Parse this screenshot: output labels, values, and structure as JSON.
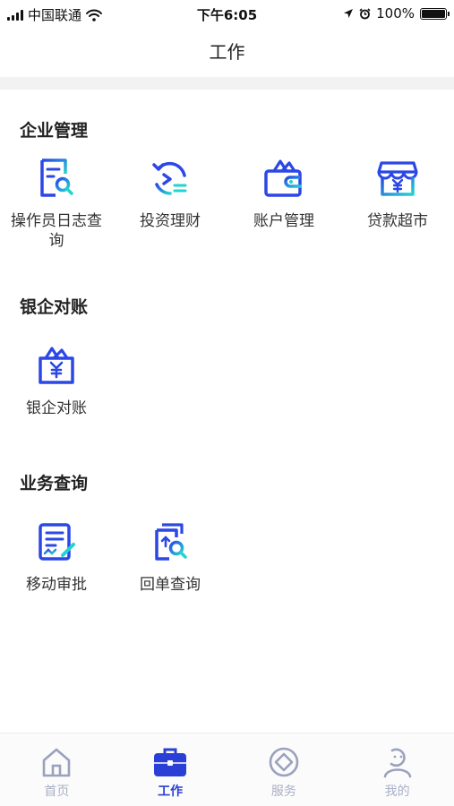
{
  "status_bar": {
    "carrier": "中国联通",
    "time": "下午6:05",
    "battery": "100%"
  },
  "header": {
    "title": "工作"
  },
  "sections": [
    {
      "title": "企业管理",
      "items": [
        {
          "label": "操作员日志查询",
          "icon": "operator-log-search-icon"
        },
        {
          "label": "投资理财",
          "icon": "investment-icon"
        },
        {
          "label": "账户管理",
          "icon": "wallet-icon"
        },
        {
          "label": "贷款超市",
          "icon": "loan-store-icon"
        }
      ]
    },
    {
      "title": "银企对账",
      "items": [
        {
          "label": "银企对账",
          "icon": "bank-reconcile-icon"
        }
      ]
    },
    {
      "title": "业务查询",
      "items": [
        {
          "label": "移动审批",
          "icon": "mobile-approval-icon"
        },
        {
          "label": "回单查询",
          "icon": "receipt-search-icon"
        }
      ]
    }
  ],
  "tab_bar": {
    "tabs": [
      {
        "label": "首页",
        "icon": "home-icon",
        "active": false
      },
      {
        "label": "工作",
        "icon": "briefcase-icon",
        "active": true
      },
      {
        "label": "服务",
        "icon": "service-icon",
        "active": false
      },
      {
        "label": "我的",
        "icon": "profile-icon",
        "active": false
      }
    ]
  },
  "colors": {
    "accent": "#2a3fd6",
    "icon_gradient_start": "#2b47e6",
    "icon_gradient_end": "#22d4d0",
    "tab_inactive": "#aab0c6"
  }
}
